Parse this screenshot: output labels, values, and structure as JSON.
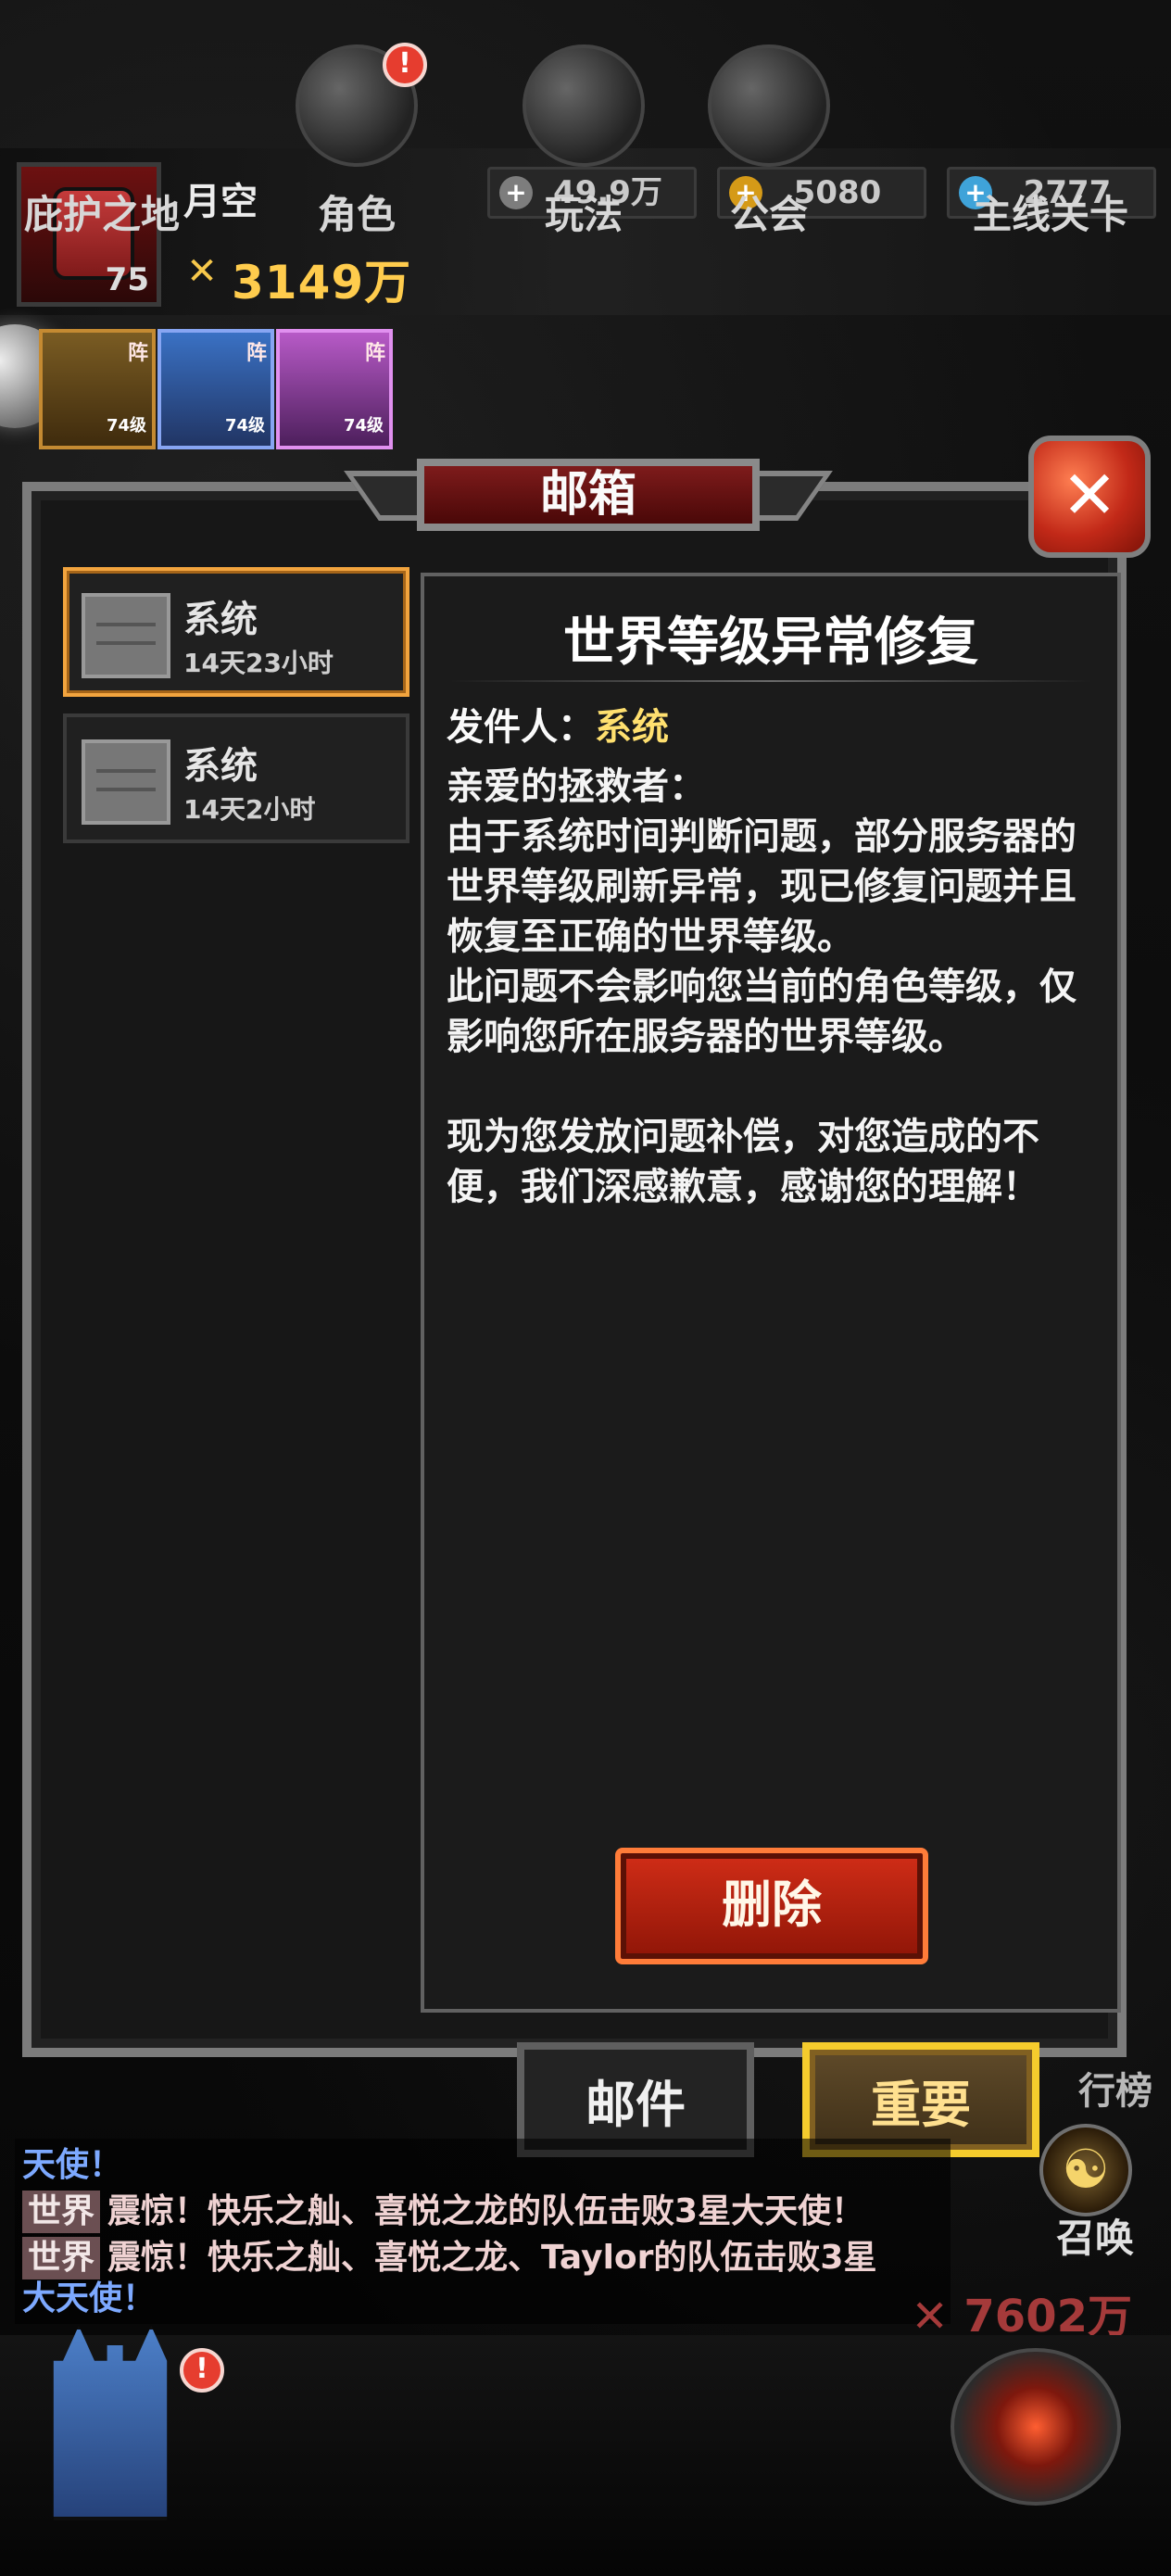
{
  "player": {
    "name": "月空",
    "level": "75",
    "power": "3149万"
  },
  "resources": [
    {
      "icon": "silver-coin-plus-icon",
      "value": "49.9万"
    },
    {
      "icon": "gold-coin-plus-icon",
      "value": "5080"
    },
    {
      "icon": "diamond-plus-icon",
      "value": "2777"
    }
  ],
  "lineup": [
    {
      "tag": "阵",
      "level": "74级"
    },
    {
      "tag": "阵",
      "level": "74级"
    },
    {
      "tag": "阵",
      "level": "74级"
    }
  ],
  "mailbox": {
    "title": "邮箱",
    "close_icon": "close-icon",
    "items": [
      {
        "sender": "系统",
        "time": "14天23小时"
      },
      {
        "sender": "系统",
        "time": "14天2小时"
      }
    ],
    "selected_mail": {
      "title": "世界等级异常修复",
      "sender_label": "发件人：",
      "sender_name": "系统",
      "body": "亲爱的拯救者：\n由于系统时间判断问题，部分服务器的世界等级刷新异常，现已修复问题并且恢复至正确的世界等级。\n此问题不会影响您当前的角色等级，仅影响您所在服务器的世界等级。\n\n现为您发放问题补偿，对您造成的不便，我们深感歉意，感谢您的理解！",
      "delete_label": "删除"
    },
    "tabs": [
      {
        "label": "邮件"
      },
      {
        "label": "重要"
      }
    ]
  },
  "bottom_side": {
    "rank_label": "行榜",
    "summon_label": "召唤",
    "power": "7602万"
  },
  "chat": [
    {
      "type": "fragment",
      "text": "天使！"
    },
    {
      "channel": "世界",
      "text": "震惊！快乐之舢、喜悦之龙的队伍击败3星大天使！"
    },
    {
      "channel": "世界",
      "text": "震惊！快乐之舢、喜悦之龙、Taylor的队伍击败3星"
    },
    {
      "type": "fragment",
      "text": "大天使！"
    }
  ],
  "nav": [
    {
      "label": "庇护之地"
    },
    {
      "label": "角色"
    },
    {
      "label": "玩法"
    },
    {
      "label": "公会"
    },
    {
      "label": "主线关卡"
    }
  ]
}
